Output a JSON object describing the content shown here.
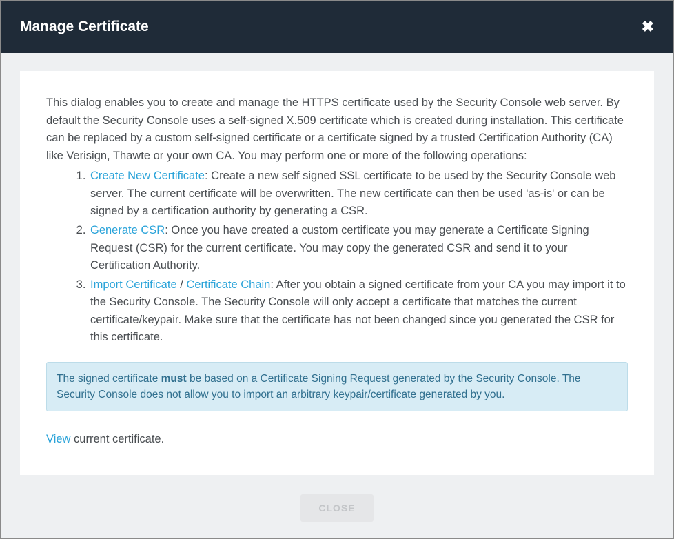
{
  "header": {
    "title": "Manage Certificate"
  },
  "intro": "This dialog enables you to create and manage the HTTPS certificate used by the Security Console web server. By default the Security Console uses a self-signed X.509 certificate which is created during installation. This certificate can be replaced by a custom self-signed certificate or a certificate signed by a trusted Certification Authority (CA) like Verisign, Thawte or your own CA. You may perform one or more of the following operations:",
  "ops": [
    {
      "link": "Create New Certificate",
      "text": ": Create a new self signed SSL certificate to be used by the Security Console web server. The current certificate will be overwritten. The new certificate can then be used 'as-is' or can be signed by a certification authority by generating a CSR."
    },
    {
      "link": "Generate CSR",
      "text": ": Once you have created a custom certificate you may generate a Certificate Signing Request (CSR) for the current certificate. You may copy the generated CSR and send it to your Certification Authority."
    },
    {
      "link": "Import Certificate",
      "sep": " / ",
      "link2": "Certificate Chain",
      "text": ": After you obtain a signed certificate from your CA you may import it to the Security Console. The Security Console will only accept a certificate that matches the current certificate/keypair. Make sure that the certificate has not been changed since you generated the CSR for this certificate."
    }
  ],
  "info": {
    "pre": "The signed certificate ",
    "must": "must",
    "post": " be based on a Certificate Signing Request generated by the Security Console. The Security Console does not allow you to import an arbitrary keypair/certificate generated by you."
  },
  "view": {
    "link": "View",
    "text": " current certificate."
  },
  "footer": {
    "close": "CLOSE"
  }
}
